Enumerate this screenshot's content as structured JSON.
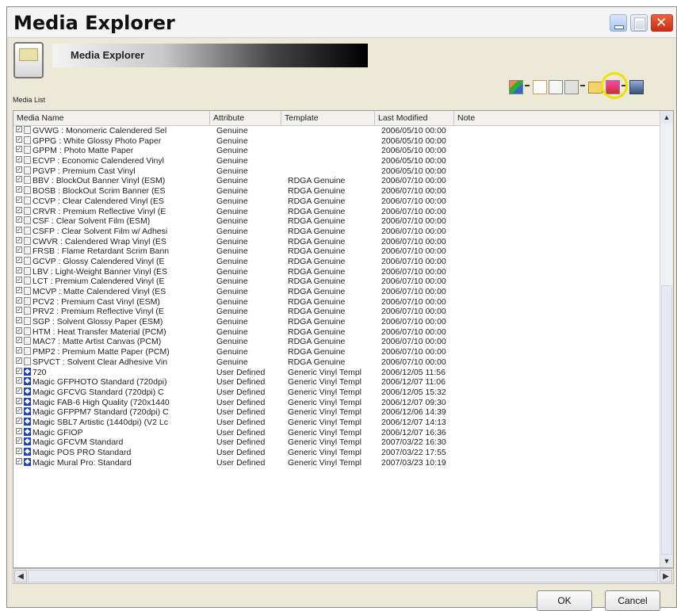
{
  "window": {
    "title": "Media Explorer",
    "banner_title": "Media Explorer",
    "section_label": "Media List"
  },
  "toolbar": {
    "icons": [
      "edit-media-icon",
      "new-media-icon",
      "copy-media-icon",
      "media-properties-icon",
      "folder-icon",
      "import-icon",
      "export-icon"
    ],
    "highlighted": "folder-icon"
  },
  "columns": [
    "Media Name",
    "Attribute",
    "Template",
    "Last Modified",
    "Note"
  ],
  "rows": [
    {
      "name": "GVWG : Monomeric Calendered Sel",
      "attribute": "Genuine",
      "template": "",
      "modified": "2006/05/10 00:00",
      "icon": "genuine"
    },
    {
      "name": "GPPG : White Glossy Photo Paper",
      "attribute": "Genuine",
      "template": "",
      "modified": "2006/05/10 00:00",
      "icon": "genuine"
    },
    {
      "name": "GPPM : Photo Matte Paper",
      "attribute": "Genuine",
      "template": "",
      "modified": "2006/05/10 00:00",
      "icon": "genuine"
    },
    {
      "name": "ECVP : Economic Calendered Vinyl",
      "attribute": "Genuine",
      "template": "",
      "modified": "2006/05/10 00:00",
      "icon": "genuine"
    },
    {
      "name": "PGVP : Premium Cast Vinyl",
      "attribute": "Genuine",
      "template": "",
      "modified": "2006/05/10 00:00",
      "icon": "genuine"
    },
    {
      "name": "BBV : BlockOut Banner Vinyl (ESM)",
      "attribute": "Genuine",
      "template": "RDGA Genuine",
      "modified": "2006/07/10 00:00",
      "icon": "genuine"
    },
    {
      "name": "BOSB : BlockOut Scrim Banner (ES",
      "attribute": "Genuine",
      "template": "RDGA Genuine",
      "modified": "2006/07/10 00:00",
      "icon": "genuine"
    },
    {
      "name": "CCVP : Clear Calendered Vinyl (ES",
      "attribute": "Genuine",
      "template": "RDGA Genuine",
      "modified": "2006/07/10 00:00",
      "icon": "genuine"
    },
    {
      "name": "CRVR : Premium Reflective Vinyl (E",
      "attribute": "Genuine",
      "template": "RDGA Genuine",
      "modified": "2006/07/10 00:00",
      "icon": "genuine"
    },
    {
      "name": "CSF : Clear Solvent Film (ESM)",
      "attribute": "Genuine",
      "template": "RDGA Genuine",
      "modified": "2006/07/10 00:00",
      "icon": "genuine"
    },
    {
      "name": "CSFP : Clear Solvent Film w/ Adhesi",
      "attribute": "Genuine",
      "template": "RDGA Genuine",
      "modified": "2006/07/10 00:00",
      "icon": "genuine"
    },
    {
      "name": "CWVR : Calendered Wrap Vinyl (ES",
      "attribute": "Genuine",
      "template": "RDGA Genuine",
      "modified": "2006/07/10 00:00",
      "icon": "genuine"
    },
    {
      "name": "FRSB : Flame Retardant Scrim Bann",
      "attribute": "Genuine",
      "template": "RDGA Genuine",
      "modified": "2006/07/10 00:00",
      "icon": "genuine"
    },
    {
      "name": "GCVP : Glossy Calendered Vinyl (E",
      "attribute": "Genuine",
      "template": "RDGA Genuine",
      "modified": "2006/07/10 00:00",
      "icon": "genuine"
    },
    {
      "name": "LBV : Light-Weight Banner Vinyl (ES",
      "attribute": "Genuine",
      "template": "RDGA Genuine",
      "modified": "2006/07/10 00:00",
      "icon": "genuine"
    },
    {
      "name": "LCT : Premium Calendered Vinyl (E",
      "attribute": "Genuine",
      "template": "RDGA Genuine",
      "modified": "2006/07/10 00:00",
      "icon": "genuine"
    },
    {
      "name": "MCVP : Matte Calendered Vinyl (ES",
      "attribute": "Genuine",
      "template": "RDGA Genuine",
      "modified": "2006/07/10 00:00",
      "icon": "genuine"
    },
    {
      "name": "PCV2 : Premium Cast Vinyl (ESM)",
      "attribute": "Genuine",
      "template": "RDGA Genuine",
      "modified": "2006/07/10 00:00",
      "icon": "genuine"
    },
    {
      "name": "PRV2 : Premium Reflective Vinyl (E",
      "attribute": "Genuine",
      "template": "RDGA Genuine",
      "modified": "2006/07/10 00:00",
      "icon": "genuine"
    },
    {
      "name": "SGP : Solvent Glossy Paper (ESM)",
      "attribute": "Genuine",
      "template": "RDGA Genuine",
      "modified": "2006/07/10 00:00",
      "icon": "genuine"
    },
    {
      "name": "HTM : Heat Transfer Material (PCM)",
      "attribute": "Genuine",
      "template": "RDGA Genuine",
      "modified": "2006/07/10 00:00",
      "icon": "genuine"
    },
    {
      "name": "MAC7 : Matte Artist Canvas (PCM)",
      "attribute": "Genuine",
      "template": "RDGA Genuine",
      "modified": "2006/07/10 00:00",
      "icon": "genuine"
    },
    {
      "name": "PMP2 : Premium Matte Paper (PCM)",
      "attribute": "Genuine",
      "template": "RDGA Genuine",
      "modified": "2006/07/10 00:00",
      "icon": "genuine"
    },
    {
      "name": "SPVCT : Solvent Clear Adhesive Vin",
      "attribute": "Genuine",
      "template": "RDGA Genuine",
      "modified": "2006/07/10 00:00",
      "icon": "genuine"
    },
    {
      "name": "720",
      "attribute": "User Defined",
      "template": "Generic Vinyl Templ",
      "modified": "2006/12/05 11:56",
      "icon": "user"
    },
    {
      "name": "Magic GFPHOTO Standard (720dpi)",
      "attribute": "User Defined",
      "template": "Generic Vinyl Templ",
      "modified": "2006/12/07 11:06",
      "icon": "user"
    },
    {
      "name": "Magic GFCVG Standard (720dpi) C",
      "attribute": "User Defined",
      "template": "Generic Vinyl Templ",
      "modified": "2006/12/05 15:32",
      "icon": "user"
    },
    {
      "name": "Magic FAB-6 High Quality (720x1440",
      "attribute": "User Defined",
      "template": "Generic Vinyl Templ",
      "modified": "2006/12/07 09:30",
      "icon": "user"
    },
    {
      "name": "Magic GFPPM7 Standard (720dpi) C",
      "attribute": "User Defined",
      "template": "Generic Vinyl Templ",
      "modified": "2006/12/06 14:39",
      "icon": "user"
    },
    {
      "name": "Magic SBL7 Artistic (1440dpi) (V2 Lc",
      "attribute": "User Defined",
      "template": "Generic Vinyl Templ",
      "modified": "2006/12/07 14:13",
      "icon": "user"
    },
    {
      "name": "Magic GFIOP",
      "attribute": "User Defined",
      "template": "Generic Vinyl Templ",
      "modified": "2006/12/07 16:36",
      "icon": "user"
    },
    {
      "name": "Magic GFCVM Standard",
      "attribute": "User Defined",
      "template": "Generic Vinyl Templ",
      "modified": "2007/03/22 16:30",
      "icon": "user"
    },
    {
      "name": "Magic POS PRO Standard",
      "attribute": "User Defined",
      "template": "Generic Vinyl Templ",
      "modified": "2007/03/22 17:55",
      "icon": "user"
    },
    {
      "name": "Magic Mural Pro: Standard",
      "attribute": "User Defined",
      "template": "Generic Vinyl Templ",
      "modified": "2007/03/23 10:19",
      "icon": "user"
    }
  ],
  "buttons": {
    "ok": "OK",
    "cancel": "Cancel"
  }
}
